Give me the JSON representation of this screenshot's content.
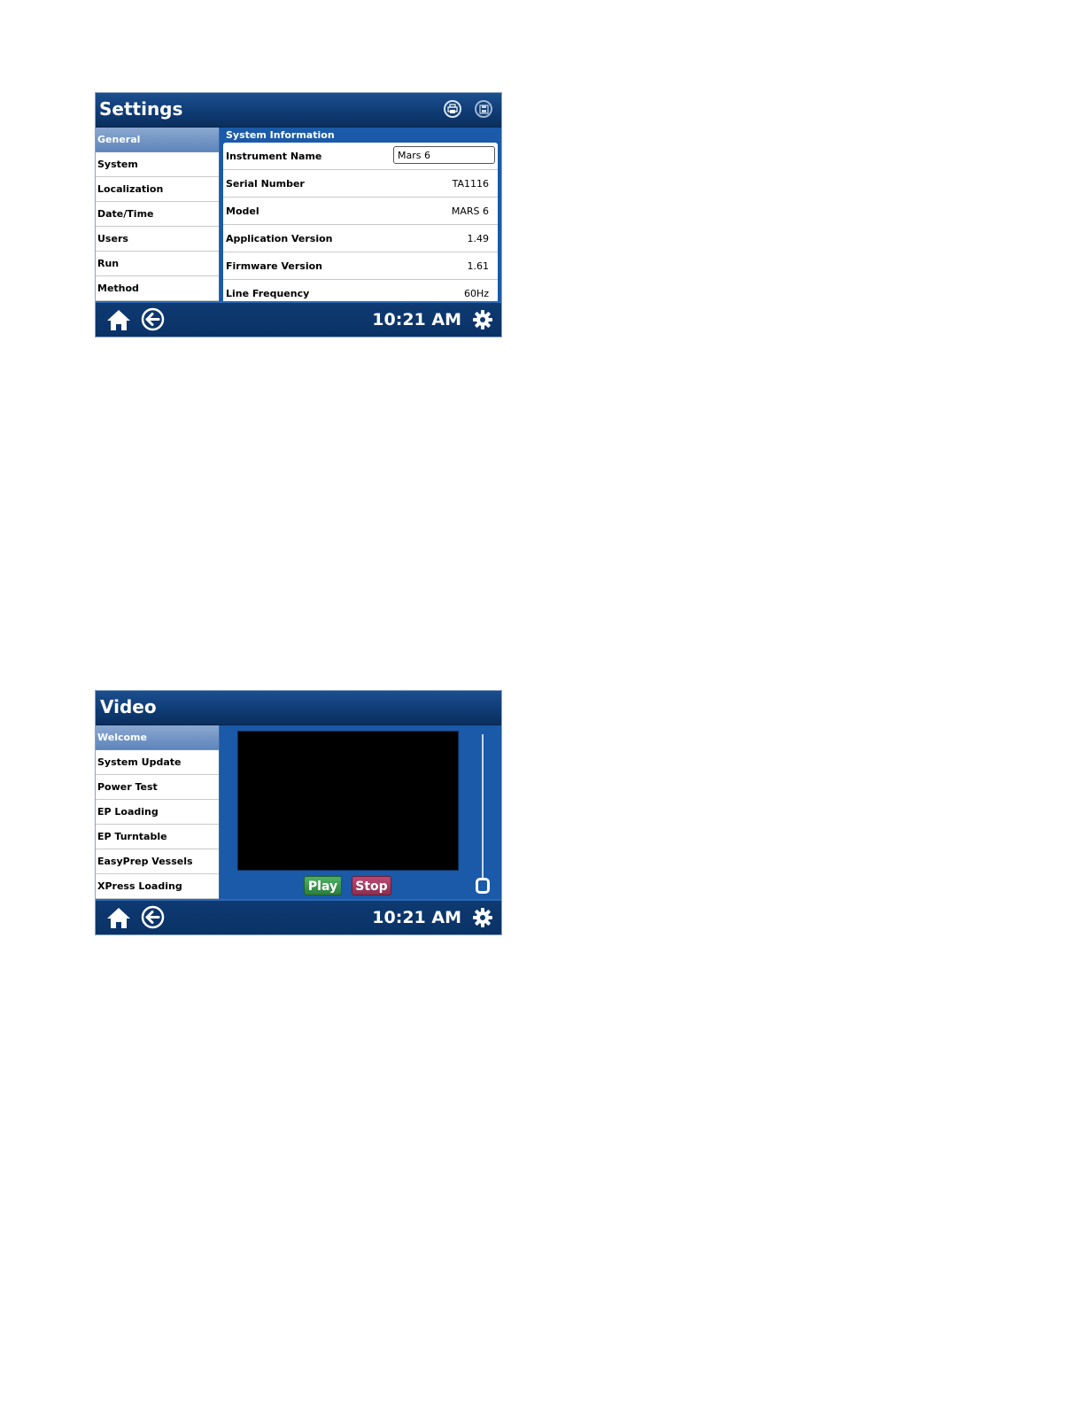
{
  "settings": {
    "title": "Settings",
    "sidebar": {
      "items": [
        {
          "label": "General",
          "active": true
        },
        {
          "label": "System"
        },
        {
          "label": "Localization"
        },
        {
          "label": "Date/Time"
        },
        {
          "label": "Users"
        },
        {
          "label": "Run"
        },
        {
          "label": "Method"
        }
      ]
    },
    "section_title": "System Information",
    "rows": [
      {
        "label": "Instrument Name",
        "value": "Mars 6",
        "editable": true
      },
      {
        "label": "Serial Number",
        "value": "TA1116"
      },
      {
        "label": "Model",
        "value": "MARS 6"
      },
      {
        "label": "Application Version",
        "value": "1.49"
      },
      {
        "label": "Firmware Version",
        "value": "1.61"
      },
      {
        "label": "Line Frequency",
        "value": "60Hz"
      }
    ],
    "header_icons": [
      "print-icon",
      "save-icon"
    ],
    "footer": {
      "time": "10:21 AM"
    }
  },
  "video": {
    "title": "Video",
    "sidebar": {
      "items": [
        {
          "label": "Welcome",
          "active": true
        },
        {
          "label": "System Update"
        },
        {
          "label": "Power Test"
        },
        {
          "label": "EP Loading"
        },
        {
          "label": "EP Turntable"
        },
        {
          "label": "EasyPrep Vessels"
        },
        {
          "label": "XPress Loading"
        }
      ]
    },
    "play_label": "Play",
    "stop_label": "Stop",
    "volume_level": 0,
    "footer": {
      "time": "10:21 AM"
    }
  },
  "colors": {
    "titlebar": "#0e3a72",
    "panel_blue": "#1a5aa8",
    "active_item": "#6f93c4",
    "play": "#3a9150",
    "stop": "#a13a61"
  }
}
